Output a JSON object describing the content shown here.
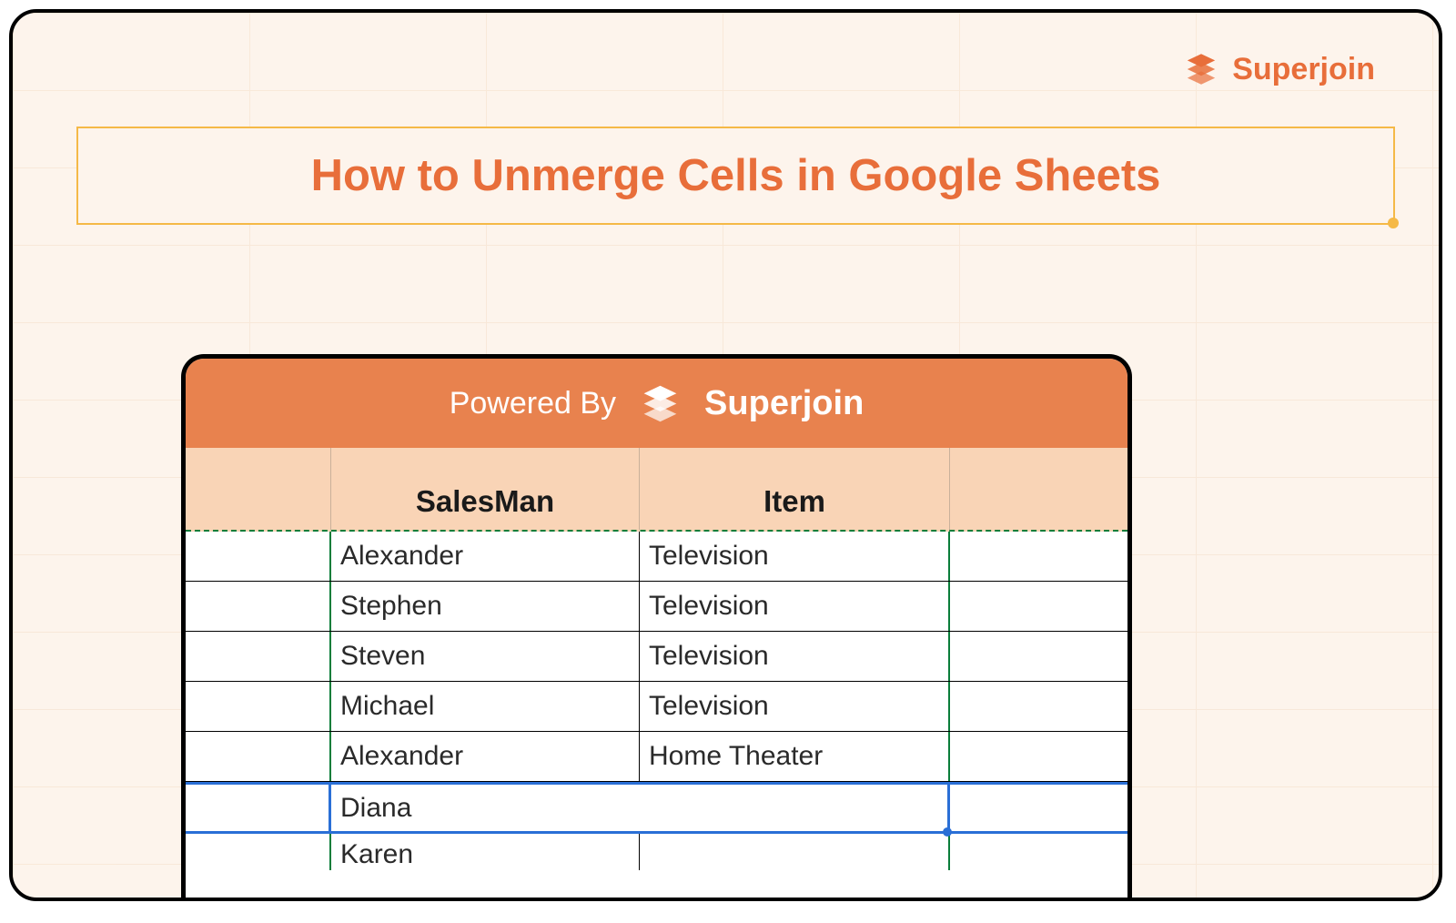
{
  "brand": {
    "name": "Superjoin"
  },
  "title": "How to Unmerge Cells in Google Sheets",
  "sheet": {
    "powered_by": "Powered By",
    "brand_name": "Superjoin",
    "headers": {
      "salesman": "SalesMan",
      "item": "Item"
    },
    "rows": [
      {
        "salesman": "Alexander",
        "item": "Television"
      },
      {
        "salesman": "Stephen",
        "item": "Television"
      },
      {
        "salesman": "Steven",
        "item": "Television"
      },
      {
        "salesman": "Michael",
        "item": "Television"
      },
      {
        "salesman": "Alexander",
        "item": "Home Theater"
      }
    ],
    "selected_merged": "Diana",
    "partial_next": "Karen"
  }
}
